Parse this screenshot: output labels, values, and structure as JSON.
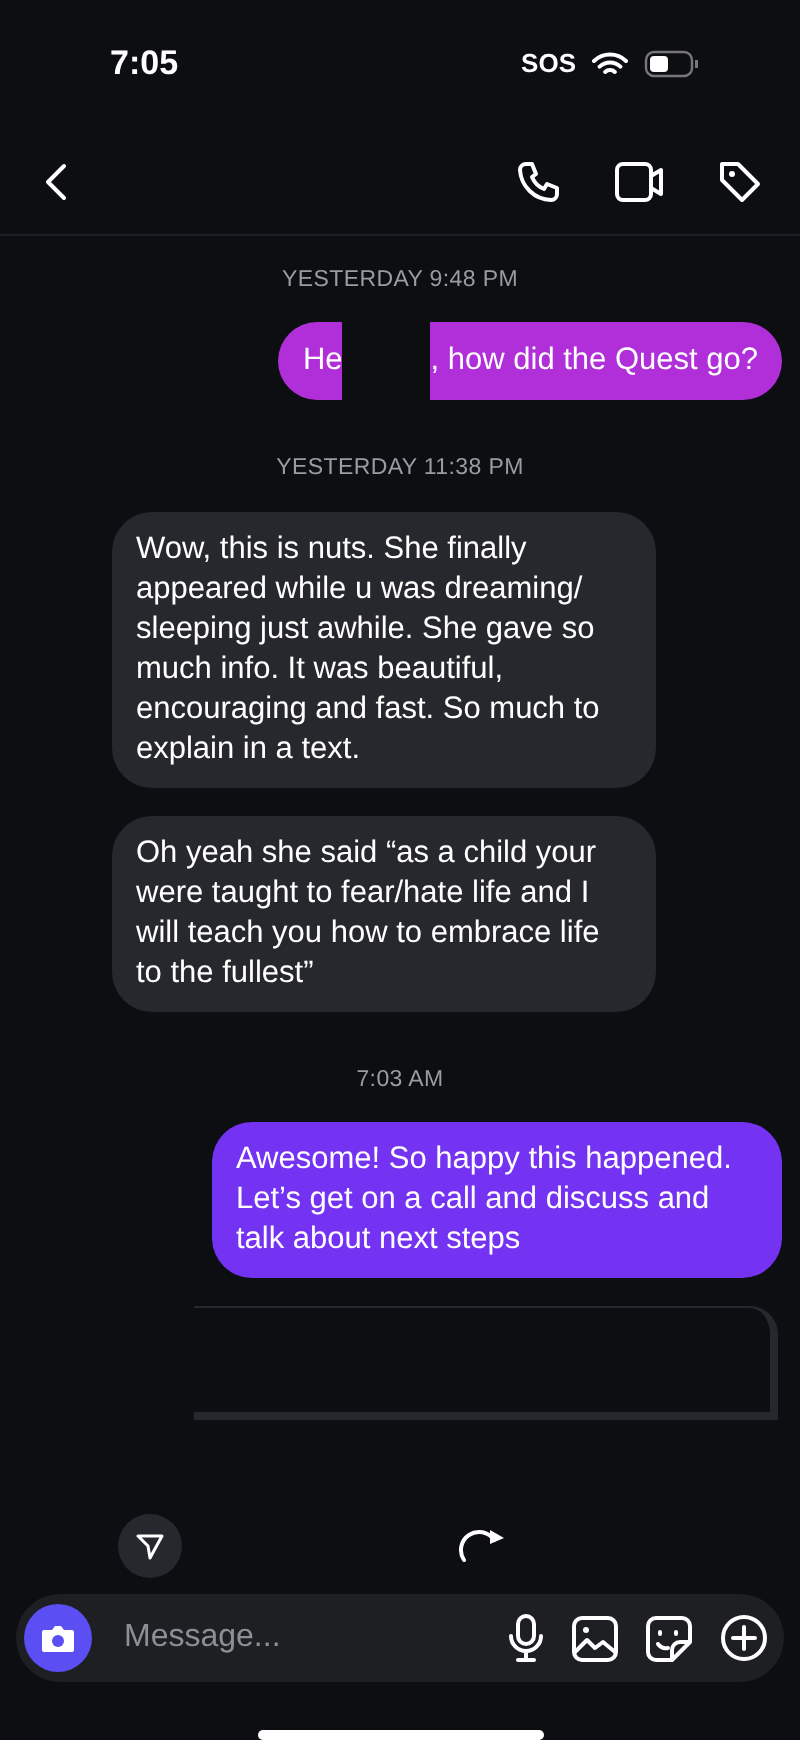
{
  "status_bar": {
    "time": "7:05",
    "sos": "SOS"
  },
  "messages": [
    {
      "kind": "timestamp",
      "text": "YESTERDAY 9:48 PM"
    },
    {
      "kind": "redacted",
      "outgoing": true,
      "color": "#b02fd9",
      "before": "He",
      "after": ", how did the Quest go?"
    },
    {
      "kind": "timestamp",
      "text": "YESTERDAY 11:38 PM"
    },
    {
      "kind": "text",
      "outgoing": false,
      "text": "Wow, this is nuts. She finally appeared while u was dreaming/ sleeping just awhile. She gave so much info. It was beautiful, encouraging and fast. So much to explain in a text."
    },
    {
      "kind": "text",
      "outgoing": false,
      "text": "Oh yeah she said “as a child your were taught to fear/hate life and I will teach you how to embrace life to the fullest”"
    },
    {
      "kind": "timestamp",
      "text": "7:03 AM"
    },
    {
      "kind": "text",
      "outgoing": true,
      "color": "#7433f2",
      "text": "Awesome! So happy this happened. Let’s get on a call and discuss and talk about next steps"
    },
    {
      "kind": "card"
    }
  ],
  "composer": {
    "placeholder": "Message..."
  }
}
